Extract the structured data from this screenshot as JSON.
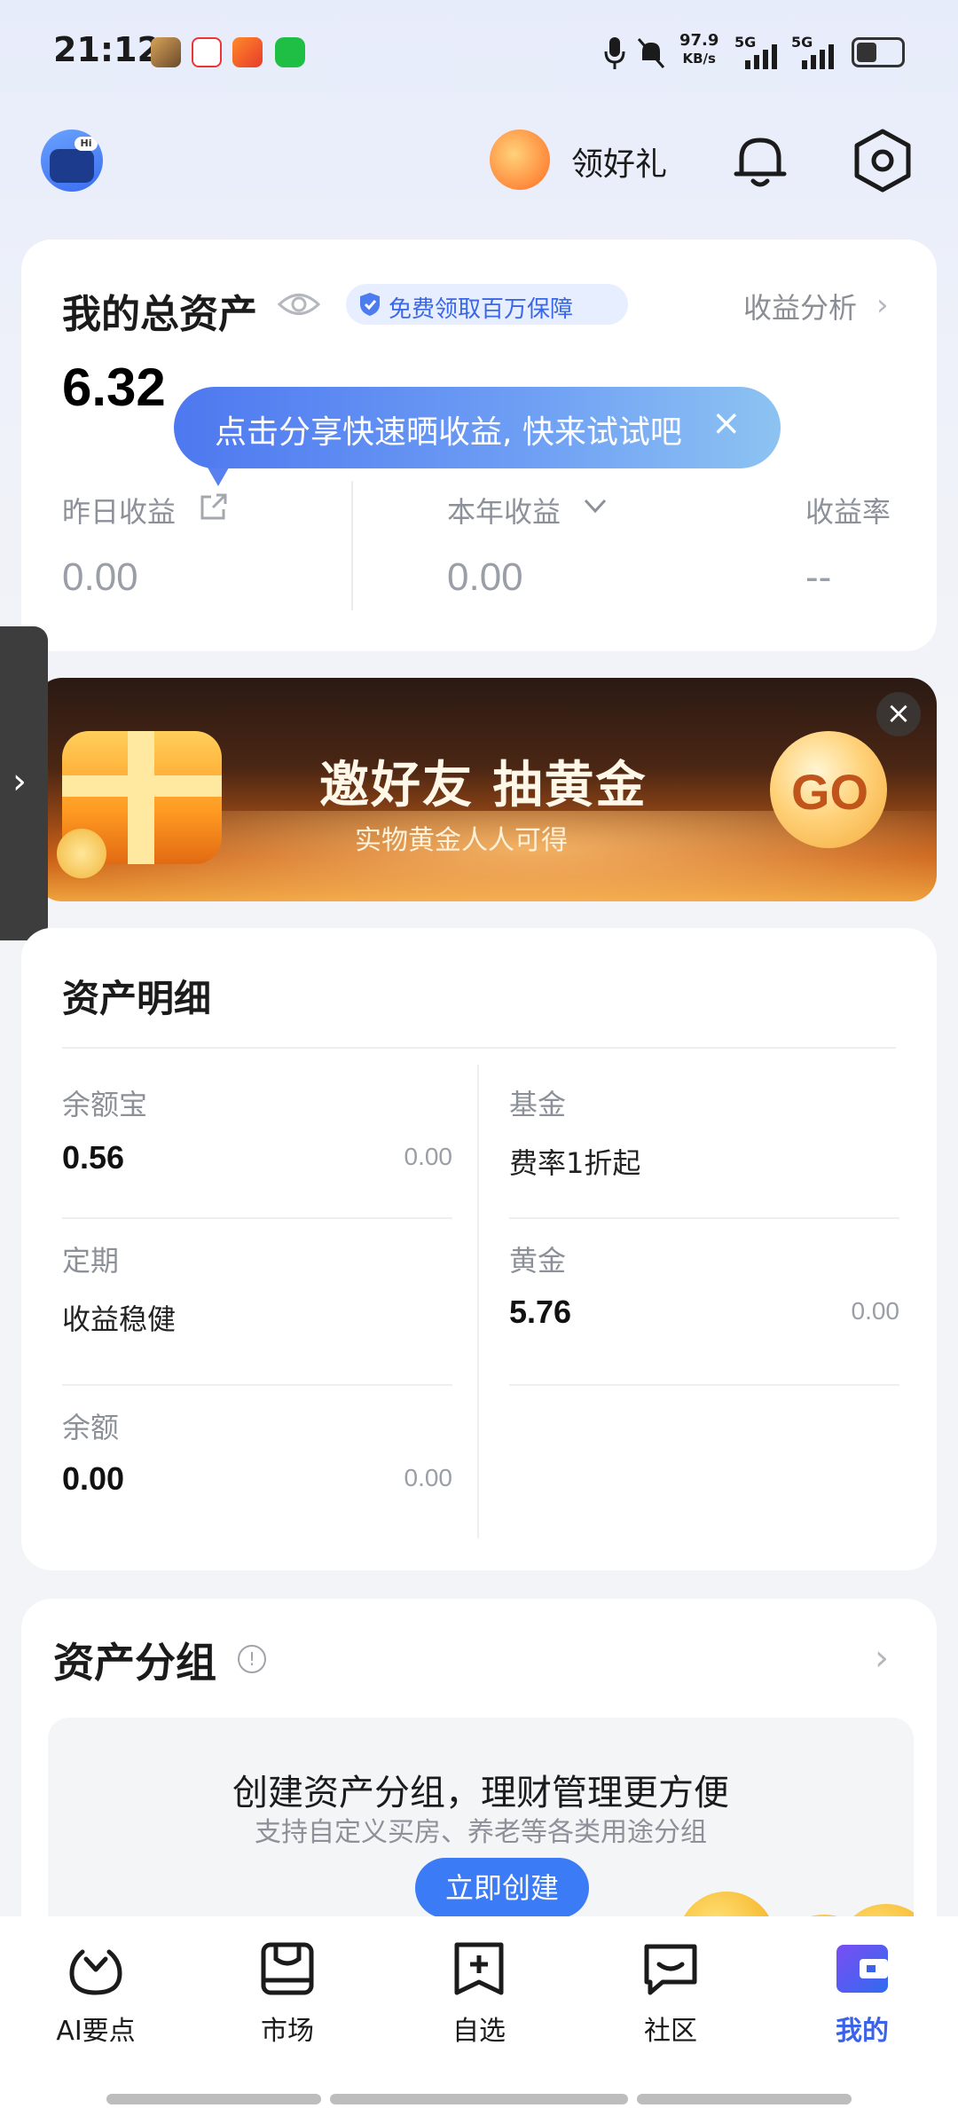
{
  "status_bar": {
    "time": "21:12",
    "net_speed": "97.9",
    "net_unit": "KB/s",
    "signal_1": "5G",
    "signal_2": "5G"
  },
  "header": {
    "gift_label": "领好礼"
  },
  "asset_card": {
    "title": "我的总资产",
    "protect_label": "免费领取百万保障",
    "analysis_label": "收益分析",
    "total_value": "6.32",
    "yesterday_label": "昨日收益",
    "yesterday_value": "0.00",
    "year_label": "本年收益",
    "year_value": "0.00",
    "rate_label": "收益率",
    "rate_value": "--"
  },
  "tooltip": {
    "text": "点击分享快速晒收益, 快来试试吧",
    "close": "×"
  },
  "banner": {
    "title": "邀好友 抽黄金",
    "subtitle": "实物黄金人人可得",
    "go": "GO",
    "close": "×"
  },
  "details": {
    "title": "资产明细",
    "items": [
      {
        "label": "余额宝",
        "value": "0.56",
        "sub": "0.00"
      },
      {
        "label": "基金",
        "text": "费率1折起"
      },
      {
        "label": "定期",
        "text": "收益稳健"
      },
      {
        "label": "黄金",
        "value": "5.76",
        "sub": "0.00"
      },
      {
        "label": "余额",
        "value": "0.00",
        "sub": "0.00"
      }
    ]
  },
  "groups": {
    "title": "资产分组",
    "info": "!",
    "headline": "创建资产分组，理财管理更方便",
    "subline": "支持自定义买房、养老等各类用途分组",
    "create_button": "立即创建"
  },
  "bottom_nav": {
    "items": [
      {
        "label": "AI要点"
      },
      {
        "label": "市场"
      },
      {
        "label": "自选"
      },
      {
        "label": "社区"
      },
      {
        "label": "我的"
      }
    ],
    "active_color": "#3b62e8"
  }
}
